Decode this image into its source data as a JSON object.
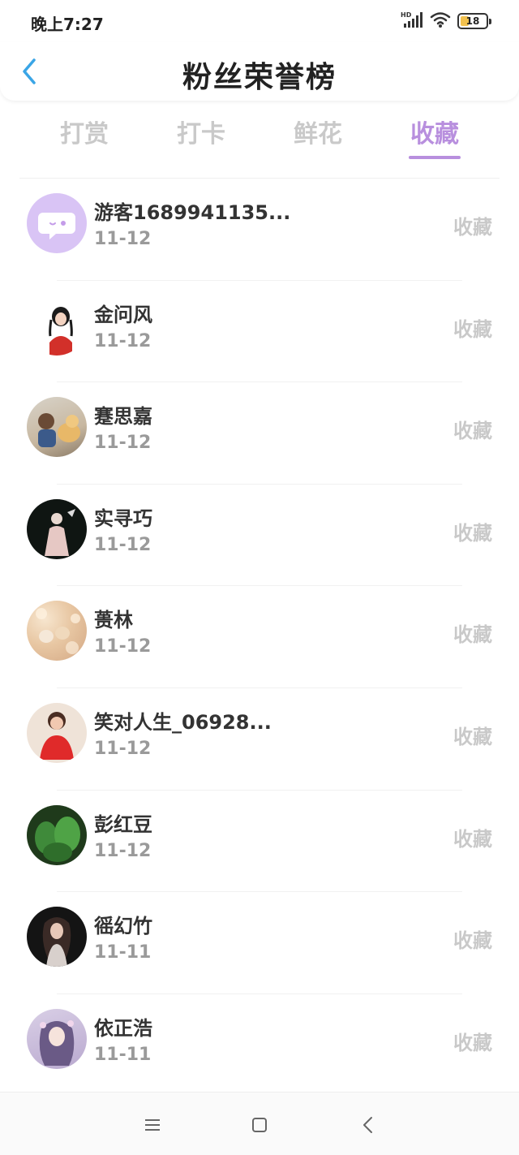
{
  "status_bar": {
    "time": "晚上7:27",
    "battery": "18",
    "network_label": "HD"
  },
  "header": {
    "title": "粉丝荣誉榜"
  },
  "tabs": [
    {
      "label": "打赏",
      "active": false
    },
    {
      "label": "打卡",
      "active": false
    },
    {
      "label": "鲜花",
      "active": false
    },
    {
      "label": "收藏",
      "active": true
    }
  ],
  "colors": {
    "accent": "#b88fde",
    "inactive": "#c9c9c9",
    "text": "#333333",
    "subtext": "#9a9a9a"
  },
  "list": [
    {
      "name": "游客1689941135...",
      "date": "11-12",
      "action": "收藏",
      "avatar": "chat-bubble-icon"
    },
    {
      "name": "金问风",
      "date": "11-12",
      "action": "收藏",
      "avatar": "girl-red-dress"
    },
    {
      "name": "蹇思嘉",
      "date": "11-12",
      "action": "收藏",
      "avatar": "child-with-dog"
    },
    {
      "name": "实寻巧",
      "date": "11-12",
      "action": "收藏",
      "avatar": "dancer-dark"
    },
    {
      "name": "蒉林",
      "date": "11-12",
      "action": "收藏",
      "avatar": "bokeh-cats"
    },
    {
      "name": "笑对人生_06928...",
      "date": "11-12",
      "action": "收藏",
      "avatar": "woman-red"
    },
    {
      "name": "彭红豆",
      "date": "11-12",
      "action": "收藏",
      "avatar": "cactus"
    },
    {
      "name": "徭幻竹",
      "date": "11-11",
      "action": "收藏",
      "avatar": "woman-dark"
    },
    {
      "name": "依正浩",
      "date": "11-11",
      "action": "收藏",
      "avatar": "anime-girl"
    }
  ],
  "bottom_nav": {
    "icons": [
      "menu-icon",
      "home-icon",
      "back-icon"
    ]
  }
}
